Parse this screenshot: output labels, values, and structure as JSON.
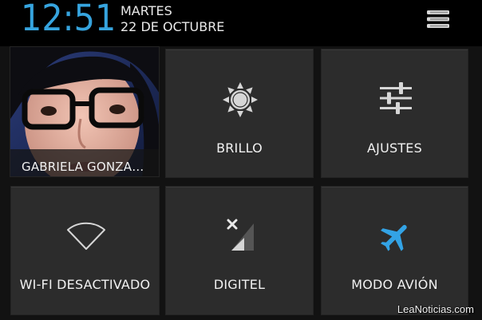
{
  "status": {
    "time": "12:51",
    "day": "MARTES",
    "date": "22 DE OCTUBRE",
    "time_color": "#36a4de"
  },
  "header_menu_icon": "list-menu-icon",
  "tiles": {
    "user": {
      "label": "GABRIELA GONZA…",
      "icon": "user-photo"
    },
    "brightness": {
      "label": "BRILLO",
      "icon": "brightness-sun-icon"
    },
    "settings": {
      "label": "AJUSTES",
      "icon": "sliders-settings-icon"
    },
    "wifi": {
      "label": "WI-FI DESACTIVADO",
      "icon": "wifi-off-icon"
    },
    "signal": {
      "label": "DIGITEL",
      "icon": "signal-no-data-icon"
    },
    "airplane": {
      "label": "MODO AVIÓN",
      "icon": "airplane-icon",
      "icon_color": "#33a3e5"
    }
  },
  "watermark": "LeaNoticias.com"
}
